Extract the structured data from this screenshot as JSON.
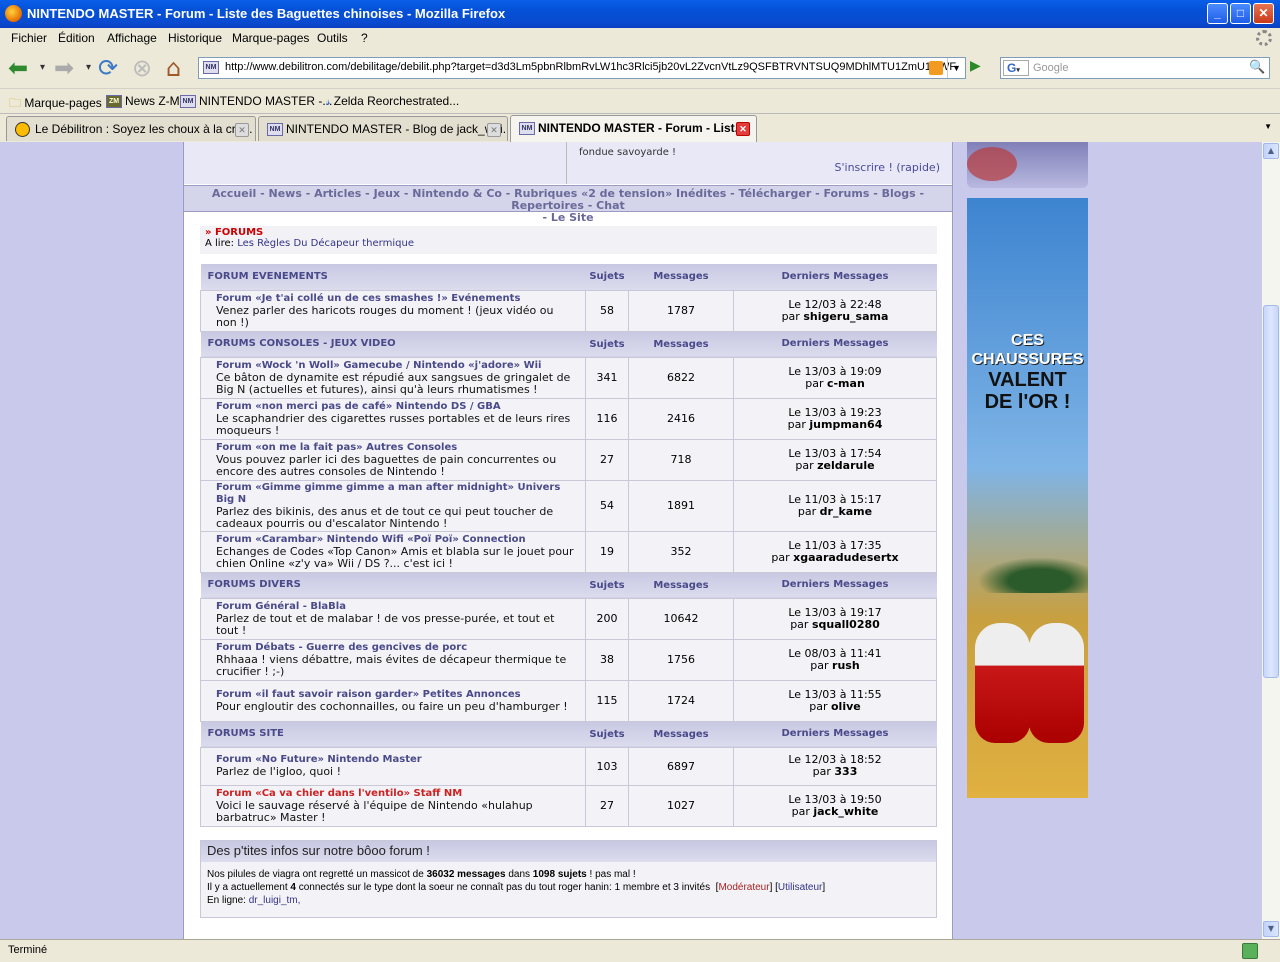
{
  "window": {
    "title": "NINTENDO MASTER - Forum - Liste des Baguettes chinoises - Mozilla Firefox"
  },
  "menu": [
    "Fichier",
    "Édition",
    "Affichage",
    "Historique",
    "Marque-pages",
    "Outils",
    "?"
  ],
  "url": "http://www.debilitron.com/debilitage/debilit.php?target=d3d3Lm5pbnRlbmRvLW1hc3Rlci5jb20vL2ZvcnVtLz9QSFBTRVNTSUQ9MDhlMTU1ZmU1NWF",
  "url_icon": "NM",
  "search_placeholder": "Google",
  "search_engine_icon": "G",
  "bookmarks": [
    {
      "label": "Marque-pages",
      "icon": "folder-icon"
    },
    {
      "label": "News Z-M",
      "icon": "ZM"
    },
    {
      "label": "NINTENDO MASTER -...",
      "icon": "NM"
    },
    {
      "label": "Zelda Reorchestrated...",
      "icon": "zelda-icon"
    }
  ],
  "tabs": [
    {
      "label": "Le Débilitron : Soyez les choux à la crè...",
      "active": false
    },
    {
      "label": "NINTENDO MASTER - Blog de jack_whi...",
      "active": false,
      "icon": "NM"
    },
    {
      "label": "NINTENDO MASTER - Forum - List...",
      "active": true,
      "icon": "NM"
    }
  ],
  "status": "Terminé",
  "page": {
    "top_info": "fondue savoyarde !",
    "inscrire": "S'inscrire ! (rapide)",
    "nav_line1": "Accueil - News - Articles - Jeux - Nintendo & Co - Rubriques «2 de tension» Inédites - Télécharger - Forums - Blogs - Repertoires - Chat",
    "nav_line2": "- Le Site",
    "crumb_title": "FORUMS",
    "crumb_prefix": "A lire:",
    "crumb_link": "Les Règles Du Décapeur thermique",
    "col_sujets": "Sujets",
    "col_messages": "Messages",
    "col_derniers": "Derniers Messages",
    "categories": [
      {
        "name": "FORUM EVENEMENTS",
        "forums": [
          {
            "name": "Forum «Je t'ai collé un de ces smashes !» Evénements",
            "desc": "Venez parler des haricots rouges du moment ! (jeux vidéo ou non !)",
            "sujets": "58",
            "messages": "1787",
            "last_date": "Le 12/03 à 22:48",
            "last_prefix": "par",
            "last_user": "shigeru_sama"
          }
        ]
      },
      {
        "name": "FORUMS CONSOLES - JEUX VIDEO",
        "forums": [
          {
            "name": "Forum «Wock 'n Woll» Gamecube / Nintendo «j'adore» Wii",
            "desc": "Ce bâton de dynamite est répudié aux sangsues de gringalet de Big N (actuelles et futures), ainsi qu'à leurs rhumatismes !",
            "sujets": "341",
            "messages": "6822",
            "last_date": "Le 13/03 à 19:09",
            "last_prefix": "par",
            "last_user": "c-man"
          },
          {
            "name": "Forum «non merci pas de café» Nintendo DS / GBA",
            "desc": "Le scaphandrier des cigarettes russes portables et de leurs rires moqueurs !",
            "sujets": "116",
            "messages": "2416",
            "last_date": "Le 13/03 à 19:23",
            "last_prefix": "par",
            "last_user": "jumpman64"
          },
          {
            "name": "Forum «on me la fait pas» Autres Consoles",
            "desc": "Vous pouvez parler ici des baguettes de pain concurrentes ou encore des autres consoles de Nintendo !",
            "sujets": "27",
            "messages": "718",
            "last_date": "Le 13/03 à 17:54",
            "last_prefix": "par",
            "last_user": "zeldarule"
          },
          {
            "name": "Forum «Gimme gimme gimme a man after midnight» Univers Big N",
            "desc": "Parlez des bikinis, des anus et de tout ce qui peut toucher de cadeaux pourris ou d'escalator Nintendo !",
            "sujets": "54",
            "messages": "1891",
            "last_date": "Le 11/03 à 15:17",
            "last_prefix": "par",
            "last_user": "dr_kame"
          },
          {
            "name": "Forum «Carambar» Nintendo Wifi «Poï Poï» Connection",
            "desc": "Echanges de Codes «Top Canon» Amis et blabla sur le jouet pour chien Online «z'y va» Wii / DS ?... c'est ici !",
            "sujets": "19",
            "messages": "352",
            "last_date": "Le 11/03 à 17:35",
            "last_prefix": "par",
            "last_user": "xgaaradudesertx"
          }
        ]
      },
      {
        "name": "FORUMS DIVERS",
        "forums": [
          {
            "name": "Forum Général - BlaBla",
            "desc": "Parlez de tout et de malabar ! de vos presse-purée, et tout et tout !",
            "sujets": "200",
            "messages": "10642",
            "last_date": "Le 13/03 à 19:17",
            "last_prefix": "par",
            "last_user": "squall0280"
          },
          {
            "name": "Forum Débats - Guerre des gencives de porc",
            "desc": "Rhhaaa ! viens débattre, mais évites de décapeur thermique te crucifier ! ;-)",
            "sujets": "38",
            "messages": "1756",
            "last_date": "Le 08/03 à 11:41",
            "last_prefix": "par",
            "last_user": "rush"
          },
          {
            "name": "Forum «il faut savoir raison garder» Petites Annonces",
            "desc": "Pour engloutir des cochonnailles, ou faire un peu d'hamburger !",
            "sujets": "115",
            "messages": "1724",
            "last_date": "Le 13/03 à 11:55",
            "last_prefix": "par",
            "last_user": "olive"
          }
        ]
      },
      {
        "name": "FORUMS SITE",
        "forums": [
          {
            "name": "Forum «No Future» Nintendo Master",
            "desc": "Parlez de l'igloo, quoi !",
            "sujets": "103",
            "messages": "6897",
            "last_date": "Le 12/03 à 18:52",
            "last_prefix": "par",
            "last_user": "333"
          },
          {
            "name": "Forum «Ca va chier dans l'ventilo» Staff NM",
            "desc": "Voici le sauvage réservé à l'équipe de Nintendo «hulahup barbatruc» Master !",
            "sujets": "27",
            "messages": "1027",
            "last_date": "Le 13/03 à 19:50",
            "last_prefix": "par",
            "last_user": "jack_white",
            "staff": true
          }
        ]
      }
    ],
    "info_title": "Des p'tites infos sur notre bôoo forum !",
    "info_line1_a": "Nos pilules de viagra ont regretté un massicot de",
    "info_msgs": "36032 messages",
    "info_line1_b": "dans",
    "info_sujets": "1098 sujets",
    "info_line1_c": "! pas mal !",
    "info_line2_a": "Il y a actuellement",
    "info_count": "4",
    "info_line2_b": "connectés sur le type dont la soeur ne connaît pas du tout roger hanin: 1 membre et 3 invités",
    "info_mod": "Modérateur",
    "info_user": "Utilisateur",
    "info_online_label": "En ligne:",
    "info_online_user": "dr_luigi_tm,"
  },
  "ad": {
    "line1": "CES",
    "line2": "CHAUSSURES",
    "line3": "VALENT",
    "line4": "DE l'OR !"
  }
}
